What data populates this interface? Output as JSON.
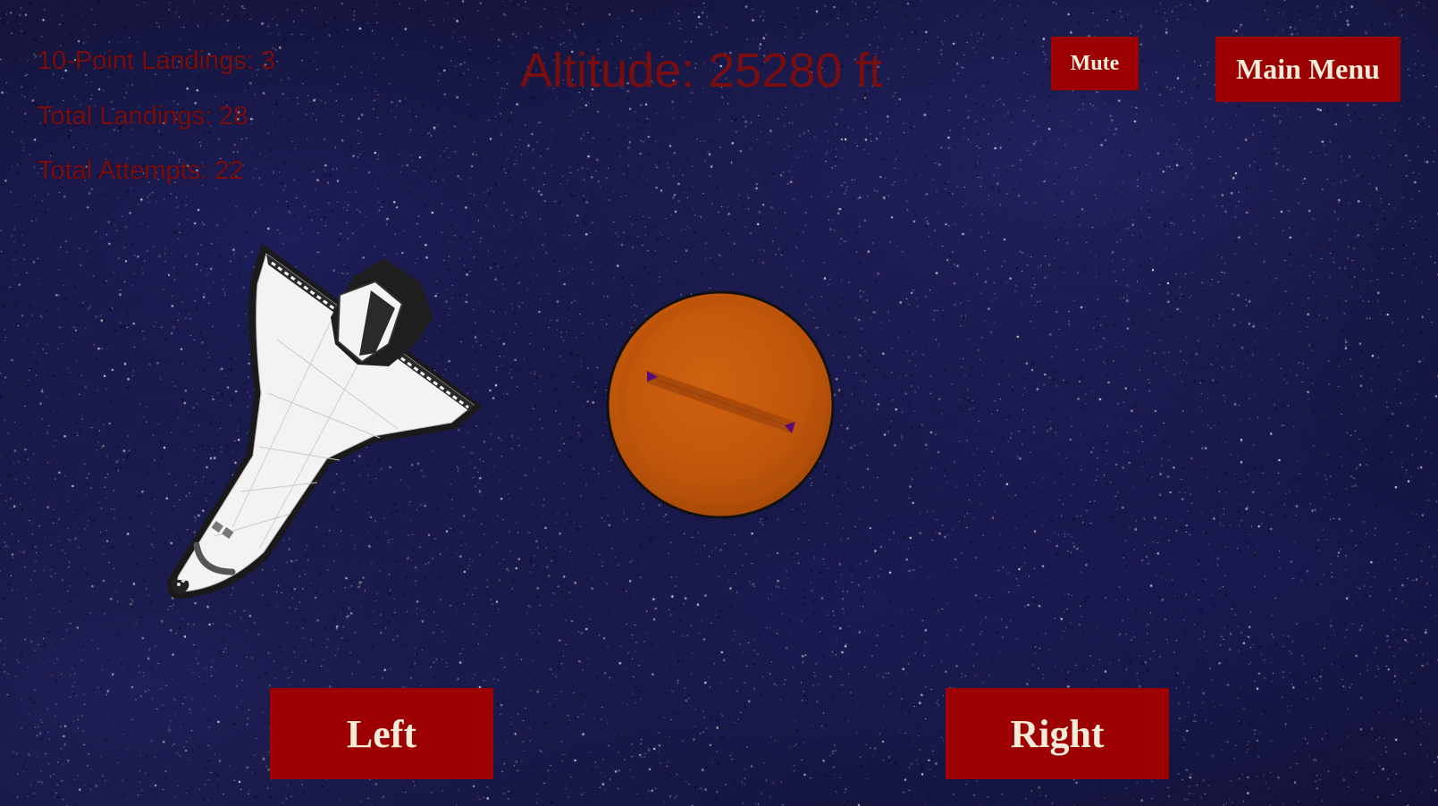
{
  "hud": {
    "ten_point_landings": "10-Point Landings: 3",
    "total_landings": "Total Landings: 28",
    "total_attempts": "Total Attempts: 22",
    "altitude": "Altitude: 25280 ft"
  },
  "buttons": {
    "mute": "Mute",
    "main_menu": "Main Menu",
    "left": "Left",
    "right": "Right"
  },
  "colors": {
    "hud_text": "#7a0d0d",
    "button_bg": "#9c0000",
    "button_text": "#f4ecd8",
    "planet": "#c2580b",
    "space": "#111133"
  }
}
